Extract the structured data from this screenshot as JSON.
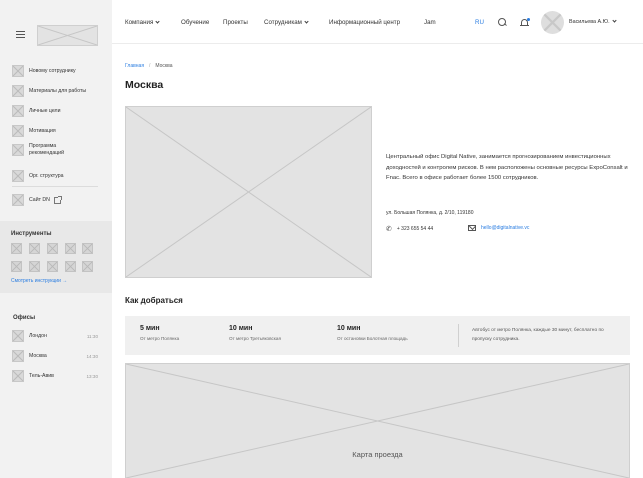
{
  "sidebar": {
    "menu": [
      {
        "label": "Новому сотруднику",
        "icon": "placeholder-icon"
      },
      {
        "label": "Материалы для работы",
        "icon": "placeholder-icon"
      },
      {
        "label": "Личные цели",
        "icon": "placeholder-icon"
      },
      {
        "label": "Мотивация",
        "icon": "placeholder-icon"
      },
      {
        "label": "Программа рекомендаций",
        "icon": "placeholder-icon"
      },
      {
        "label": "Орг. структура",
        "icon": "placeholder-icon"
      }
    ],
    "site_link": {
      "label": "Сайт DN",
      "icon": "external-link-icon"
    },
    "tools": {
      "title": "Инструменты",
      "link": "Смотреть инструкции →"
    },
    "offices": {
      "title": "Офисы",
      "items": [
        {
          "name": "Лондон",
          "time": "11:30"
        },
        {
          "name": "Москва",
          "time": "14:30"
        },
        {
          "name": "Тель-Авив",
          "time": "13:30"
        }
      ]
    }
  },
  "nav": {
    "items": [
      "Компания",
      "Обучение",
      "Проекты",
      "Сотрудникам",
      "Информационный центр",
      "Jam"
    ],
    "lang": "RU",
    "user_name": "Васильева А.Ю."
  },
  "breadcrumb": {
    "home": "Главная",
    "current": "Москва"
  },
  "page": {
    "title": "Москва",
    "description": "Центральный офис Digital Native, занимается прогнозированием инвестиционных доходностей и контролем рисков. В нем расположены основные ресурсы ExpoConsalt и Fnac. Всего в офисе работает более 1500 сотрудников.",
    "address": "ул. Большая Полянка, д. 2/10, 119180",
    "phone": "+ 323 655 54 44",
    "email": "hello@digitalnative.vc"
  },
  "directions": {
    "title": "Как добраться",
    "routes": [
      {
        "time": "5 мин",
        "from": "От метро Полянка"
      },
      {
        "time": "10 мин",
        "from": "От метро Третьяковская"
      },
      {
        "time": "10 мин",
        "from": "От остановки Болотная площадь"
      }
    ],
    "note": "Автобус от метро Полянка, каждые 30 минут, бесплатно по пропуску сотрудника.",
    "map_label": "Карта проезда"
  },
  "colors": {
    "accent": "#2a7de1",
    "sidebar_bg": "#f2f2f2",
    "placeholder": "#e3e3e3"
  }
}
